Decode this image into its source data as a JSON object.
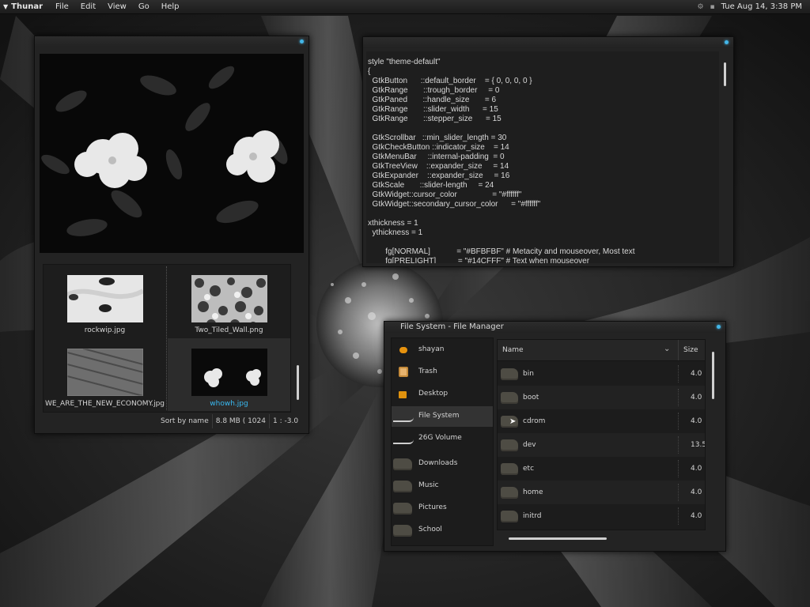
{
  "panel": {
    "app_name": "Thunar",
    "menus": [
      "File",
      "Edit",
      "View",
      "Go",
      "Help"
    ],
    "clock": "Tue Aug 14,  3:38 PM"
  },
  "viewer": {
    "thumbnails": [
      {
        "name": "rockwip.jpg",
        "selected": false
      },
      {
        "name": "Two_Tiled_Wall.png",
        "selected": false
      },
      {
        "name": "WE_ARE_THE_NEW_ECONOMY.jpg",
        "selected": false
      },
      {
        "name": "whowh.jpg",
        "selected": true
      }
    ],
    "status": {
      "sort": "Sort by name",
      "size": "8.8 MB ( 1024",
      "zoom": "1 : -3.0"
    }
  },
  "terminal": {
    "lines": [
      "style \"theme-default\"",
      "{",
      "  GtkButton      ::default_border    = { 0, 0, 0, 0 }",
      "  GtkRange       ::trough_border     = 0",
      "  GtkPaned       ::handle_size       = 6",
      "  GtkRange       ::slider_width      = 15",
      "  GtkRange       ::stepper_size      = 15",
      "",
      "  GtkScrollbar   ::min_slider_length = 30",
      "  GtkCheckButton ::indicator_size    = 14",
      "  GtkMenuBar     ::internal-padding  = 0",
      "  GtkTreeView    ::expander_size     = 14",
      "  GtkExpander    ::expander_size     = 16",
      "  GtkScale       ::slider-length     = 24",
      "  GtkWidget::cursor_color                = \"#ffffff\"",
      "  GtkWidget::secondary_cursor_color      = \"#ffffff\"",
      "",
      "xthickness = 1",
      "  ythickness = 1",
      "",
      "        fg[NORMAL]            = \"#BFBFBF\" # Metacity and mouseover, Most text",
      "        fg[PRELIGHT]          = \"#14CFFF\" # Text when mouseover"
    ]
  },
  "filemanager": {
    "title": "File System - File Manager",
    "sidebar": [
      {
        "label": "shayan",
        "icon": "home-icon",
        "selected": false
      },
      {
        "label": "Trash",
        "icon": "trash-icon",
        "selected": false
      },
      {
        "label": "Desktop",
        "icon": "desktop-icon",
        "selected": false
      },
      {
        "label": "File System",
        "icon": "drive-icon",
        "selected": true
      },
      {
        "label": "26G Volume",
        "icon": "drive-icon",
        "selected": false
      },
      {
        "label": "Downloads",
        "icon": "folder-icon",
        "selected": false
      },
      {
        "label": "Music",
        "icon": "folder-icon",
        "selected": false
      },
      {
        "label": "Pictures",
        "icon": "folder-icon",
        "selected": false
      },
      {
        "label": "School",
        "icon": "folder-icon",
        "selected": false
      }
    ],
    "columns": {
      "name": "Name",
      "size": "Size"
    },
    "files": [
      {
        "name": "bin",
        "size": "4.0"
      },
      {
        "name": "boot",
        "size": "4.0"
      },
      {
        "name": "cdrom",
        "size": "4.0"
      },
      {
        "name": "dev",
        "size": "13.5"
      },
      {
        "name": "etc",
        "size": "4.0"
      },
      {
        "name": "home",
        "size": "4.0"
      },
      {
        "name": "initrd",
        "size": "4.0"
      }
    ]
  }
}
